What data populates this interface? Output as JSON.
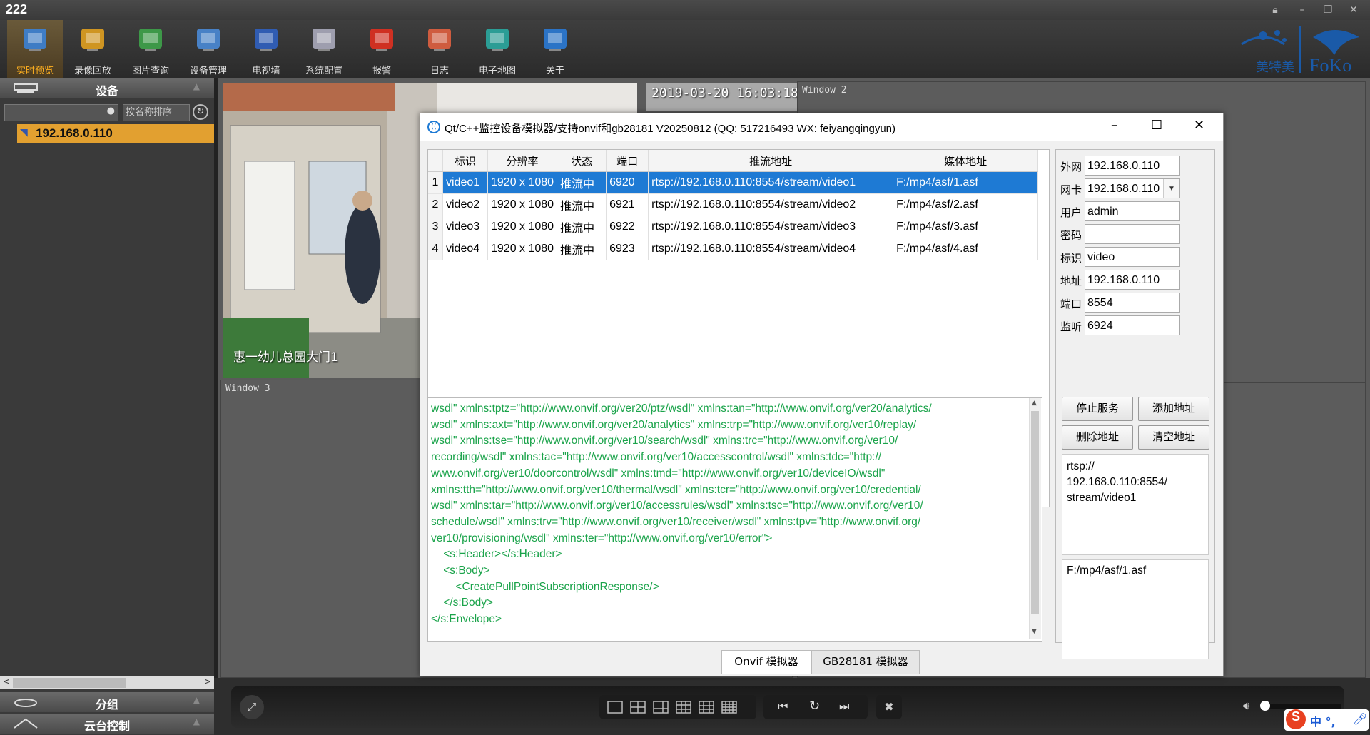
{
  "app": {
    "title": "222"
  },
  "toolbar": [
    {
      "label": "实时预览",
      "icon": "monitor-camera-icon",
      "active": true
    },
    {
      "label": "录像回放",
      "icon": "folder-play-icon"
    },
    {
      "label": "图片查询",
      "icon": "pyramid-icon"
    },
    {
      "label": "设备管理",
      "icon": "devices-icon"
    },
    {
      "label": "电视墙",
      "icon": "tv-wall-icon"
    },
    {
      "label": "系统配置",
      "icon": "server-config-icon"
    },
    {
      "label": "报警",
      "icon": "alarm-light-icon"
    },
    {
      "label": "日志",
      "icon": "log-calendar-icon"
    },
    {
      "label": "电子地图",
      "icon": "map-icon"
    },
    {
      "label": "关于",
      "icon": "info-icon"
    }
  ],
  "left": {
    "device_header": "设备",
    "search_placeholder": "",
    "sort_label": "按名称排序",
    "device": "192.168.0.110",
    "group_header": "分组",
    "ptz_header": "云台控制"
  },
  "video": {
    "timestamp": "2019-03-20  16:03:18",
    "caption": "惠一幼儿总园大门1",
    "window2": "Window 2",
    "window3": "Window 3"
  },
  "dialog": {
    "title": "Qt/C++监控设备模拟器/支持onvif和gb28181 V20250812 (QQ: 517216493 WX: feiyangqingyun)",
    "columns": [
      "标识",
      "分辨率",
      "状态",
      "端口",
      "推流地址",
      "媒体地址"
    ],
    "rows": [
      {
        "n": "1",
        "id": "video1",
        "res": "1920 x 1080",
        "state": "推流中",
        "port": "6920",
        "push": "rtsp://192.168.0.110:8554/stream/video1",
        "media": "F:/mp4/asf/1.asf"
      },
      {
        "n": "2",
        "id": "video2",
        "res": "1920 x 1080",
        "state": "推流中",
        "port": "6921",
        "push": "rtsp://192.168.0.110:8554/stream/video2",
        "media": "F:/mp4/asf/2.asf"
      },
      {
        "n": "3",
        "id": "video3",
        "res": "1920 x 1080",
        "state": "推流中",
        "port": "6922",
        "push": "rtsp://192.168.0.110:8554/stream/video3",
        "media": "F:/mp4/asf/3.asf"
      },
      {
        "n": "4",
        "id": "video4",
        "res": "1920 x 1080",
        "state": "推流中",
        "port": "6923",
        "push": "rtsp://192.168.0.110:8554/stream/video4",
        "media": "F:/mp4/asf/4.asf"
      }
    ],
    "log": "wsdl\" xmlns:tptz=\"http://www.onvif.org/ver20/ptz/wsdl\" xmlns:tan=\"http://www.onvif.org/ver20/analytics/\nwsdl\" xmlns:axt=\"http://www.onvif.org/ver20/analytics\" xmlns:trp=\"http://www.onvif.org/ver10/replay/\nwsdl\" xmlns:tse=\"http://www.onvif.org/ver10/search/wsdl\" xmlns:trc=\"http://www.onvif.org/ver10/\nrecording/wsdl\" xmlns:tac=\"http://www.onvif.org/ver10/accesscontrol/wsdl\" xmlns:tdc=\"http://\nwww.onvif.org/ver10/doorcontrol/wsdl\" xmlns:tmd=\"http://www.onvif.org/ver10/deviceIO/wsdl\"\nxmlns:tth=\"http://www.onvif.org/ver10/thermal/wsdl\" xmlns:tcr=\"http://www.onvif.org/ver10/credential/\nwsdl\" xmlns:tar=\"http://www.onvif.org/ver10/accessrules/wsdl\" xmlns:tsc=\"http://www.onvif.org/ver10/\nschedule/wsdl\" xmlns:trv=\"http://www.onvif.org/ver10/receiver/wsdl\" xmlns:tpv=\"http://www.onvif.org/\nver10/provisioning/wsdl\" xmlns:ter=\"http://www.onvif.org/ver10/error\">\n    <s:Header></s:Header>\n    <s:Body>\n        <CreatePullPointSubscriptionResponse/>\n    </s:Body>\n</s:Envelope>",
    "form": {
      "wan_label": "外网",
      "wan": "192.168.0.110",
      "nic_label": "网卡",
      "nic": "192.168.0.110",
      "user_label": "用户",
      "user": "admin",
      "pwd_label": "密码",
      "pwd": "",
      "tag_label": "标识",
      "tag": "video",
      "addr_label": "地址",
      "addr": "192.168.0.110",
      "port_label": "端口",
      "port": "8554",
      "listen_label": "监听",
      "listen": "6924"
    },
    "buttons": {
      "stop": "停止服务",
      "add": "添加地址",
      "del": "删除地址",
      "clear": "清空地址"
    },
    "url_text": "rtsp://\n192.168.0.110:8554/\nstream/video1",
    "media_text": "F:/mp4/asf/1.asf",
    "tabs": [
      "Onvif 模拟器",
      "GB28181 模拟器"
    ]
  },
  "ime": {
    "text": "中 °,"
  }
}
